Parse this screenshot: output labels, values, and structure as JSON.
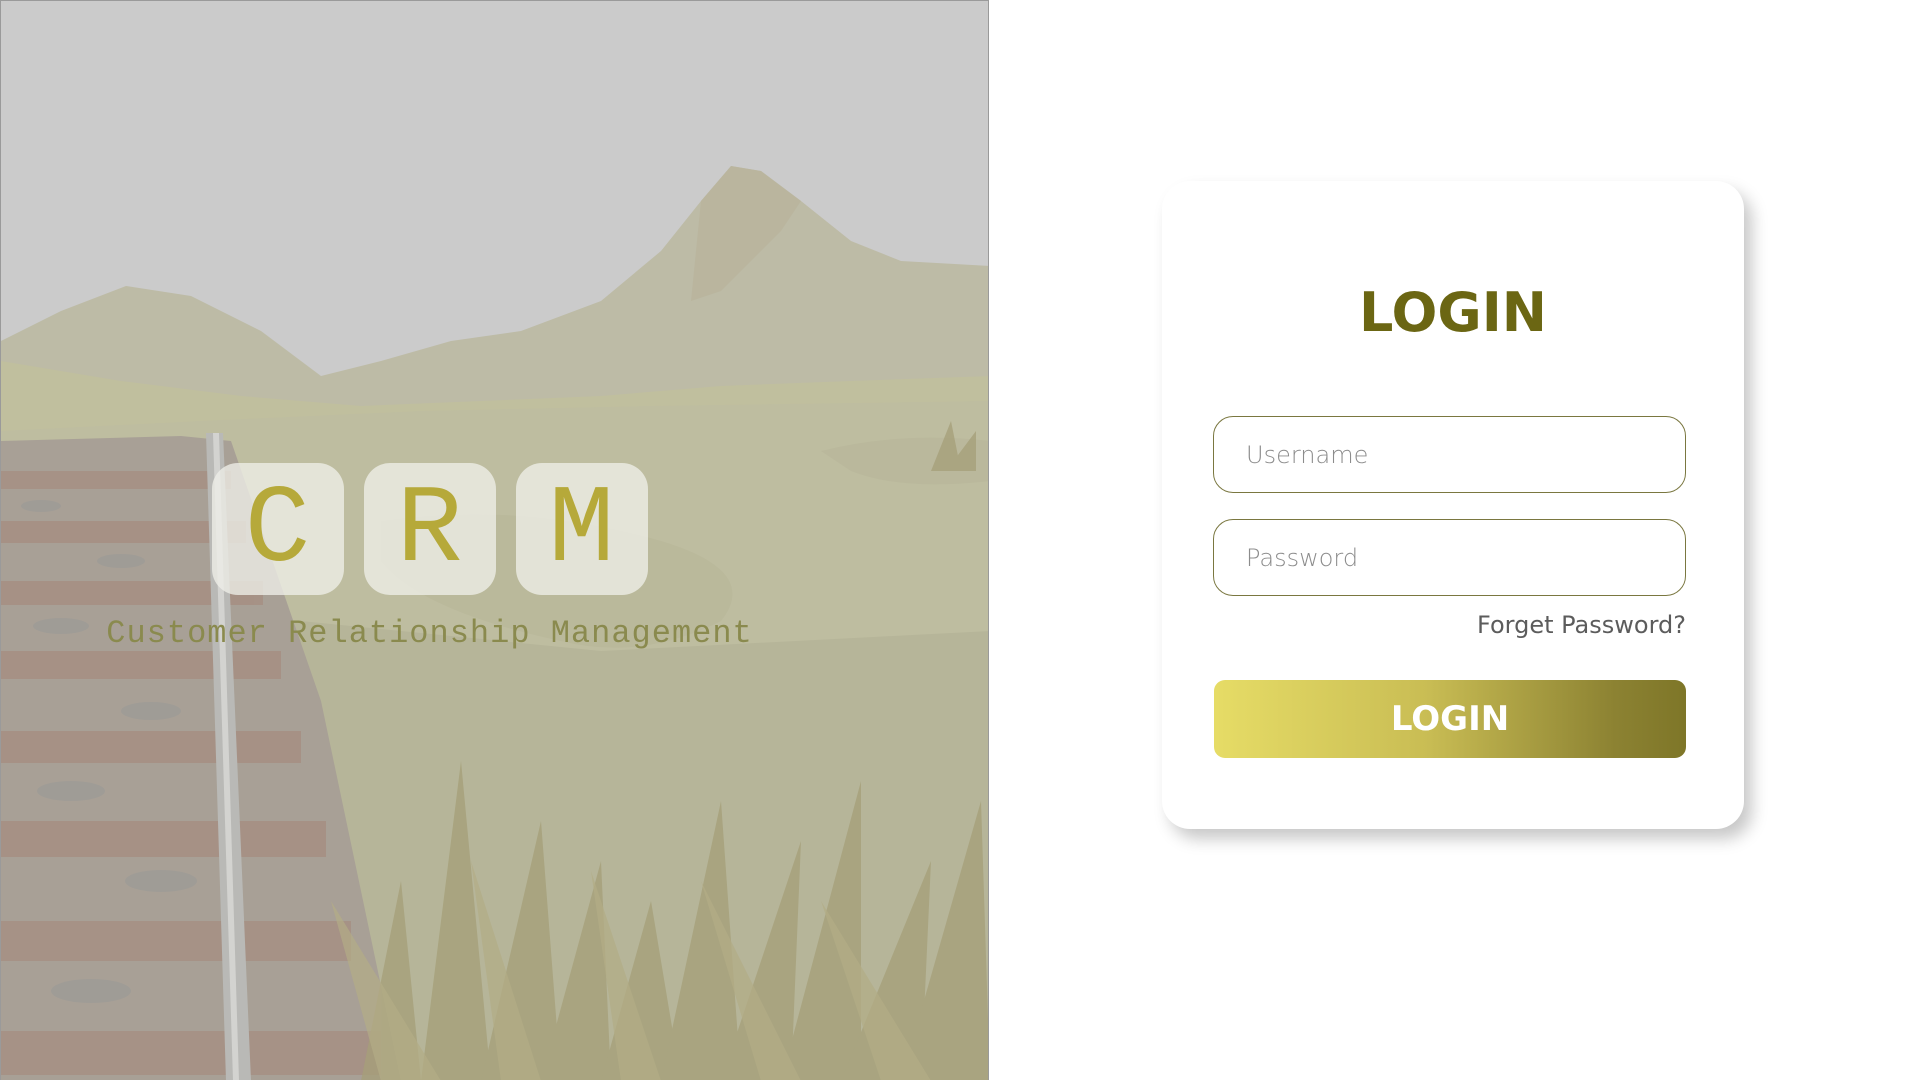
{
  "brand": {
    "letters": [
      "C",
      "R",
      "M"
    ],
    "tagline": "Customer Relationship Management"
  },
  "login_card": {
    "title": "LOGIN",
    "username_placeholder": "Username",
    "password_placeholder": "Password",
    "forgot_password": "Forget Password?",
    "login_button": "LOGIN"
  },
  "colors": {
    "title": "#6b6613",
    "letters": "#b6a93a",
    "button_gradient_start": "#e6dc66",
    "button_gradient_end": "#7e7628"
  }
}
